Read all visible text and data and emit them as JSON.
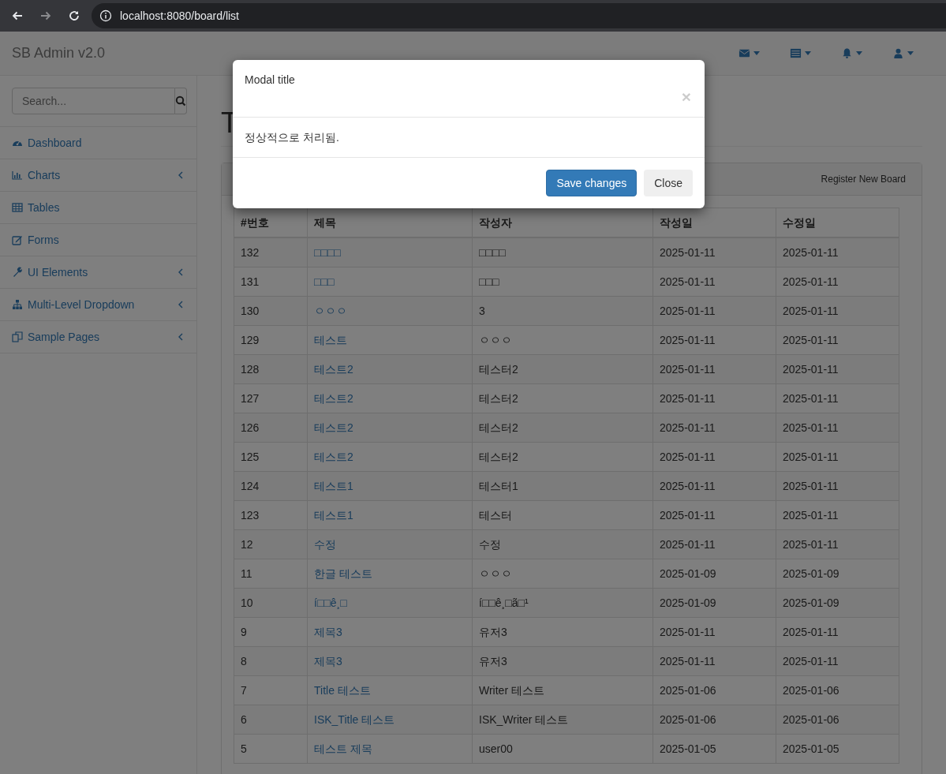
{
  "browser": {
    "url": "localhost:8080/board/list"
  },
  "navbar": {
    "brand": "SB Admin v2.0",
    "menus": [
      {
        "kind": "messages"
      },
      {
        "kind": "tasks"
      },
      {
        "kind": "alerts"
      },
      {
        "kind": "user"
      }
    ]
  },
  "sidebar": {
    "search_placeholder": "Search...",
    "items": [
      {
        "label": "Dashboard",
        "kind": "dashboard",
        "has_submenu": false
      },
      {
        "label": "Charts",
        "kind": "charts",
        "has_submenu": true
      },
      {
        "label": "Tables",
        "kind": "tables",
        "has_submenu": false
      },
      {
        "label": "Forms",
        "kind": "forms",
        "has_submenu": false
      },
      {
        "label": "UI Elements",
        "kind": "wrench",
        "has_submenu": true
      },
      {
        "label": "Multi-Level Dropdown",
        "kind": "sitemap",
        "has_submenu": true
      },
      {
        "label": "Sample Pages",
        "kind": "pages",
        "has_submenu": true
      }
    ]
  },
  "page": {
    "heading": "T",
    "panel": {
      "register_button": "Register New Board"
    },
    "table": {
      "columns": [
        "#번호",
        "제목",
        "작성자",
        "작성일",
        "수정일"
      ],
      "rows": [
        {
          "no": "132",
          "title": "□□□□",
          "writer": "□□□□",
          "created": "2025-01-11",
          "modified": "2025-01-11"
        },
        {
          "no": "131",
          "title": "□□□",
          "writer": "□□□",
          "created": "2025-01-11",
          "modified": "2025-01-11"
        },
        {
          "no": "130",
          "title": "ㅇㅇㅇ",
          "writer": "3",
          "created": "2025-01-11",
          "modified": "2025-01-11"
        },
        {
          "no": "129",
          "title": "테스트",
          "writer": "ㅇㅇㅇ",
          "created": "2025-01-11",
          "modified": "2025-01-11"
        },
        {
          "no": "128",
          "title": "테스트2",
          "writer": "테스터2",
          "created": "2025-01-11",
          "modified": "2025-01-11"
        },
        {
          "no": "127",
          "title": "테스트2",
          "writer": "테스터2",
          "created": "2025-01-11",
          "modified": "2025-01-11"
        },
        {
          "no": "126",
          "title": "테스트2",
          "writer": "테스터2",
          "created": "2025-01-11",
          "modified": "2025-01-11"
        },
        {
          "no": "125",
          "title": "테스트2",
          "writer": "테스터2",
          "created": "2025-01-11",
          "modified": "2025-01-11"
        },
        {
          "no": "124",
          "title": "테스트1",
          "writer": "테스터1",
          "created": "2025-01-11",
          "modified": "2025-01-11"
        },
        {
          "no": "123",
          "title": "테스트1",
          "writer": "테스터",
          "created": "2025-01-11",
          "modified": "2025-01-11"
        },
        {
          "no": "12",
          "title": "수정",
          "writer": "수정",
          "created": "2025-01-11",
          "modified": "2025-01-11"
        },
        {
          "no": "11",
          "title": "한글 테스트",
          "writer": "ㅇㅇㅇ",
          "created": "2025-01-09",
          "modified": "2025-01-09"
        },
        {
          "no": "10",
          "title": "í□□ê¸□",
          "writer": "í□□ê¸□ã□¹",
          "created": "2025-01-09",
          "modified": "2025-01-09"
        },
        {
          "no": "9",
          "title": "제목3",
          "writer": "유저3",
          "created": "2025-01-11",
          "modified": "2025-01-11"
        },
        {
          "no": "8",
          "title": "제목3",
          "writer": "유저3",
          "created": "2025-01-11",
          "modified": "2025-01-11"
        },
        {
          "no": "7",
          "title": "Title 테스트",
          "writer": "Writer 테스트",
          "created": "2025-01-06",
          "modified": "2025-01-06"
        },
        {
          "no": "6",
          "title": "ISK_Title 테스트",
          "writer": "ISK_Writer 테스트",
          "created": "2025-01-06",
          "modified": "2025-01-06"
        },
        {
          "no": "5",
          "title": "테스트 제목",
          "writer": "user00",
          "created": "2025-01-05",
          "modified": "2025-01-05"
        }
      ]
    }
  },
  "modal": {
    "title": "Modal title",
    "close": "×",
    "body": "정상적으로 처리됨.",
    "buttons": [
      {
        "label": "Save changes",
        "kind": "primary"
      },
      {
        "label": "Close",
        "kind": "default"
      }
    ]
  }
}
